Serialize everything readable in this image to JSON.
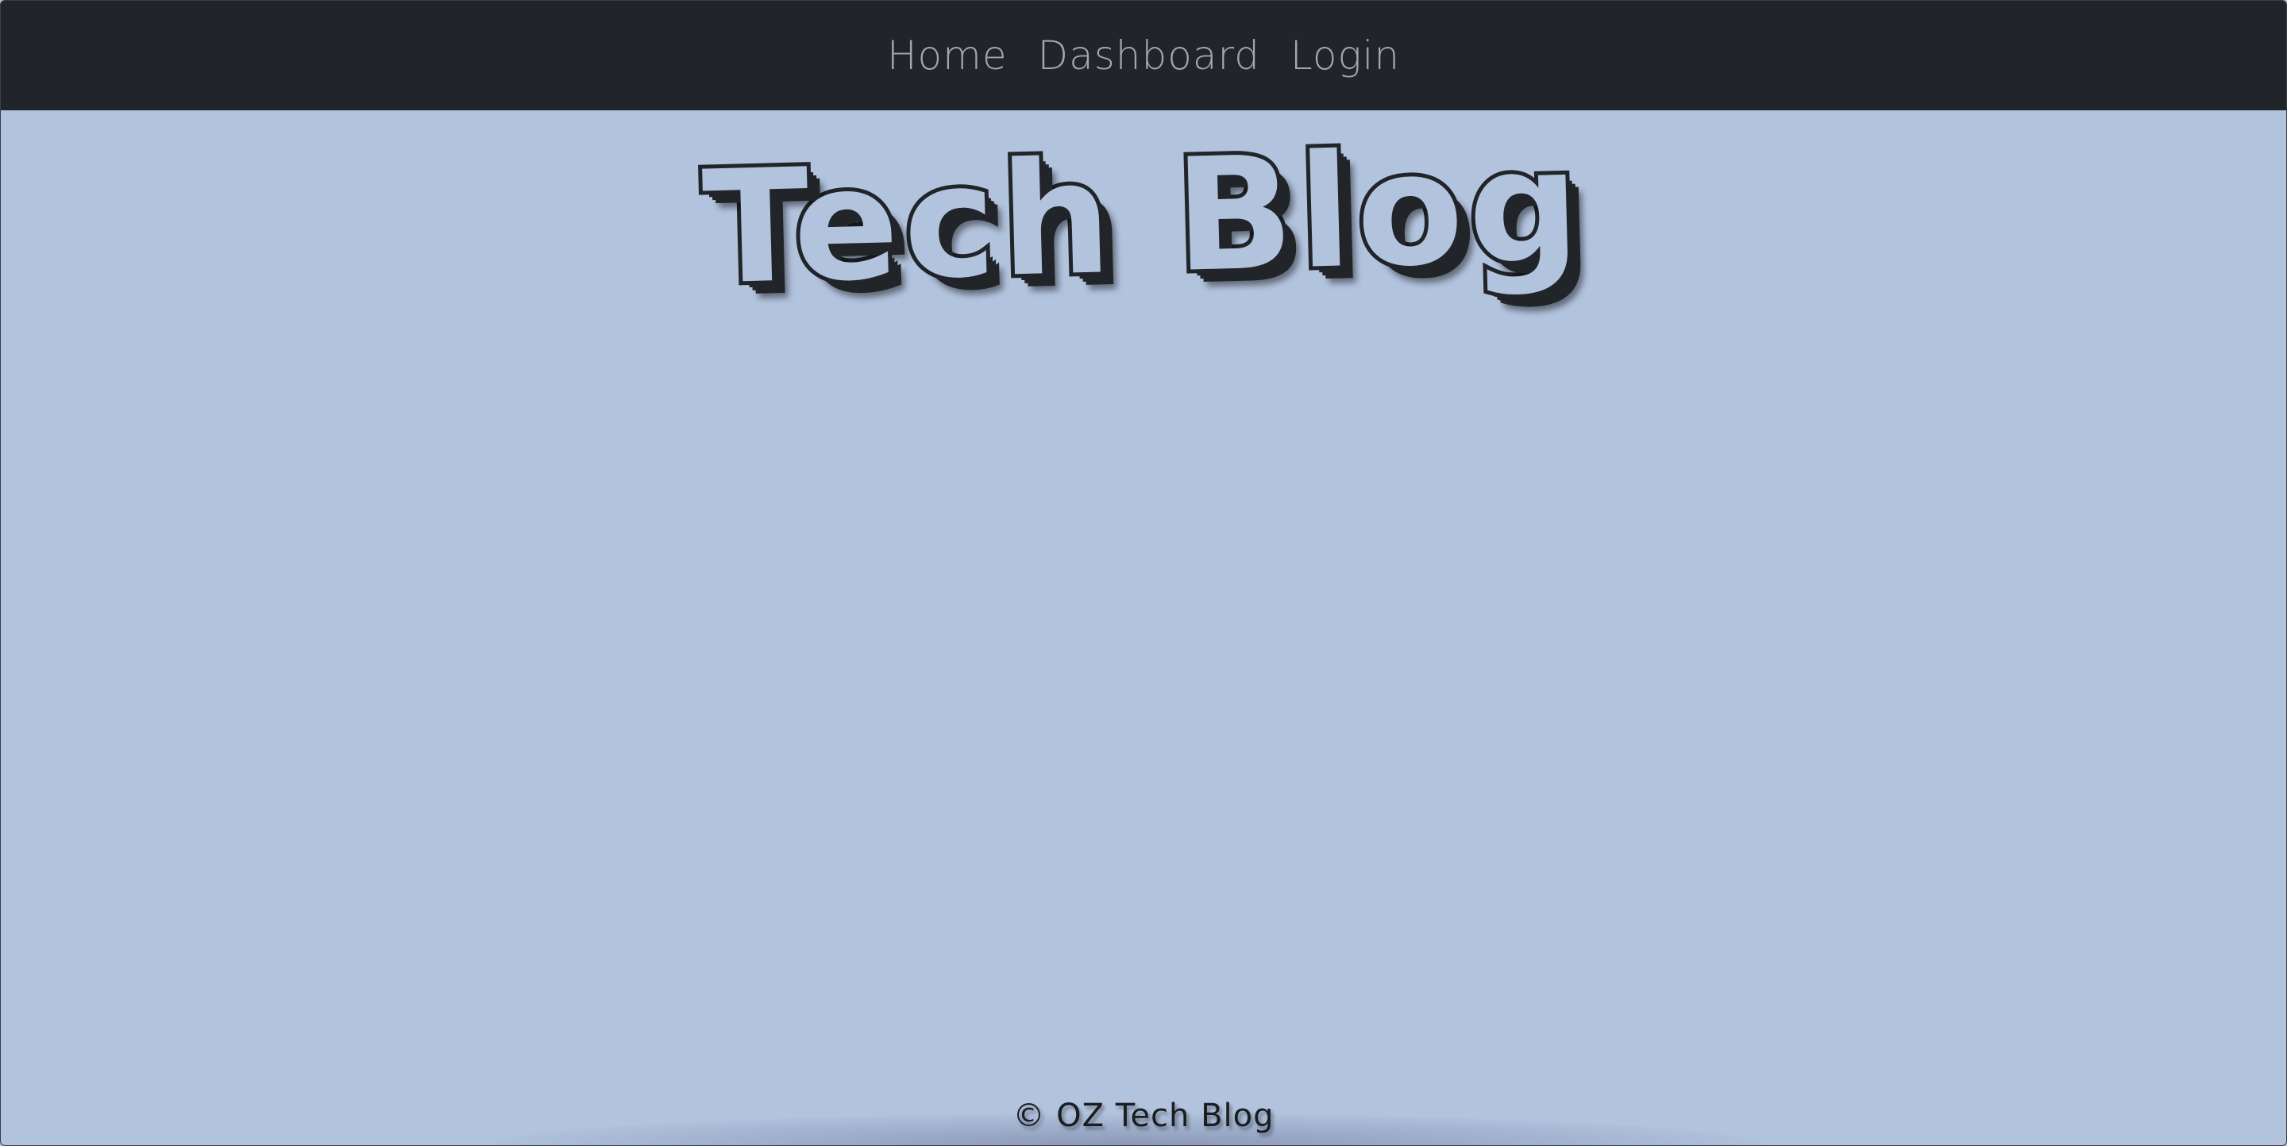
{
  "navbar": {
    "links": [
      "Home",
      "Dashboard",
      "Login"
    ]
  },
  "hero": {
    "title": "Tech Blog"
  },
  "footer": {
    "text": "© OZ Tech Blog"
  },
  "colors": {
    "navbar_bg": "#212529",
    "page_bg": "#b2c3de",
    "nav_link": "#a3a6aa",
    "title_outline": "#212529"
  }
}
